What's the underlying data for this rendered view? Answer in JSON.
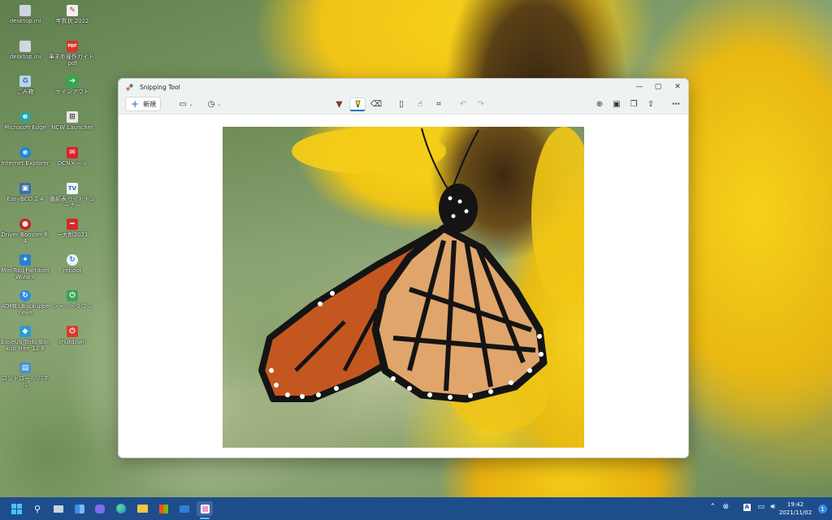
{
  "desktop_icons": [
    {
      "label": "desktop.ini",
      "icon": "settings-file-icon"
    },
    {
      "label": "年賀状 2022",
      "icon": "greeting-card-icon"
    },
    {
      "label": "desktop.ini",
      "icon": "settings-file-icon"
    },
    {
      "label": "筆まめ操作ガイド.pdf",
      "icon": "pdf-file-icon"
    },
    {
      "label": "ごみ箱",
      "icon": "recycle-bin-icon"
    },
    {
      "label": "サインアウト",
      "icon": "sign-out-icon"
    },
    {
      "label": "Microsoft Edge",
      "icon": "edge-icon"
    },
    {
      "label": "NCW Launcher",
      "icon": "ncw-launcher-icon"
    },
    {
      "label": "Internet Explorer",
      "icon": "internet-explorer-icon"
    },
    {
      "label": "OCNメール",
      "icon": "ocn-mail-icon"
    },
    {
      "label": "EasyBCD 2.4",
      "icon": "easybcd-icon"
    },
    {
      "label": "番組表ガイドチューナー",
      "icon": "tv-guide-icon"
    },
    {
      "label": "Driver Booster 8.4",
      "icon": "driver-booster-icon"
    },
    {
      "label": "一太郎2021",
      "icon": "ichitaro-icon"
    },
    {
      "label": "MiniTool Partition Wizard",
      "icon": "partition-wizard-icon"
    },
    {
      "label": "reboot",
      "icon": "reboot-icon"
    },
    {
      "label": "AOMEI Backupper.exe",
      "icon": "aomei-backupper-icon"
    },
    {
      "label": "シャットダウン",
      "icon": "shutdown-shortcut-icon"
    },
    {
      "label": "EaseUS Todo Backup Free 12.8",
      "icon": "easeus-backup-icon"
    },
    {
      "label": "shutdown",
      "icon": "shutdown-icon"
    },
    {
      "label": "コントロール パネル",
      "icon": "control-panel-icon"
    }
  ],
  "window": {
    "title": "Snipping Tool",
    "new_label": "新規",
    "toolbar_icons": [
      "snip-mode-icon",
      "delay-timer-icon",
      "ballpoint-pen-icon",
      "highlighter-icon",
      "eraser-icon",
      "ruler-icon",
      "touch-writing-icon",
      "crop-icon",
      "undo-icon",
      "redo-icon",
      "zoom-icon",
      "save-icon",
      "copy-icon",
      "share-icon",
      "more-options-icon"
    ],
    "active_tool": "highlighter-icon"
  },
  "taskbar": {
    "icons": [
      "start-icon",
      "search-icon",
      "task-view-icon",
      "widgets-icon",
      "chat-icon",
      "edge-icon",
      "file-explorer-icon",
      "store-icon",
      "mail-icon",
      "snipping-tool-icon"
    ],
    "active_app": "snipping-tool-icon",
    "time": "19:42",
    "date": "2021/11/02",
    "notification_count": "1"
  },
  "colors": {
    "taskbar": "#1e4d8c",
    "accent": "#1a73c8",
    "window_chrome": "#eef3f1"
  }
}
